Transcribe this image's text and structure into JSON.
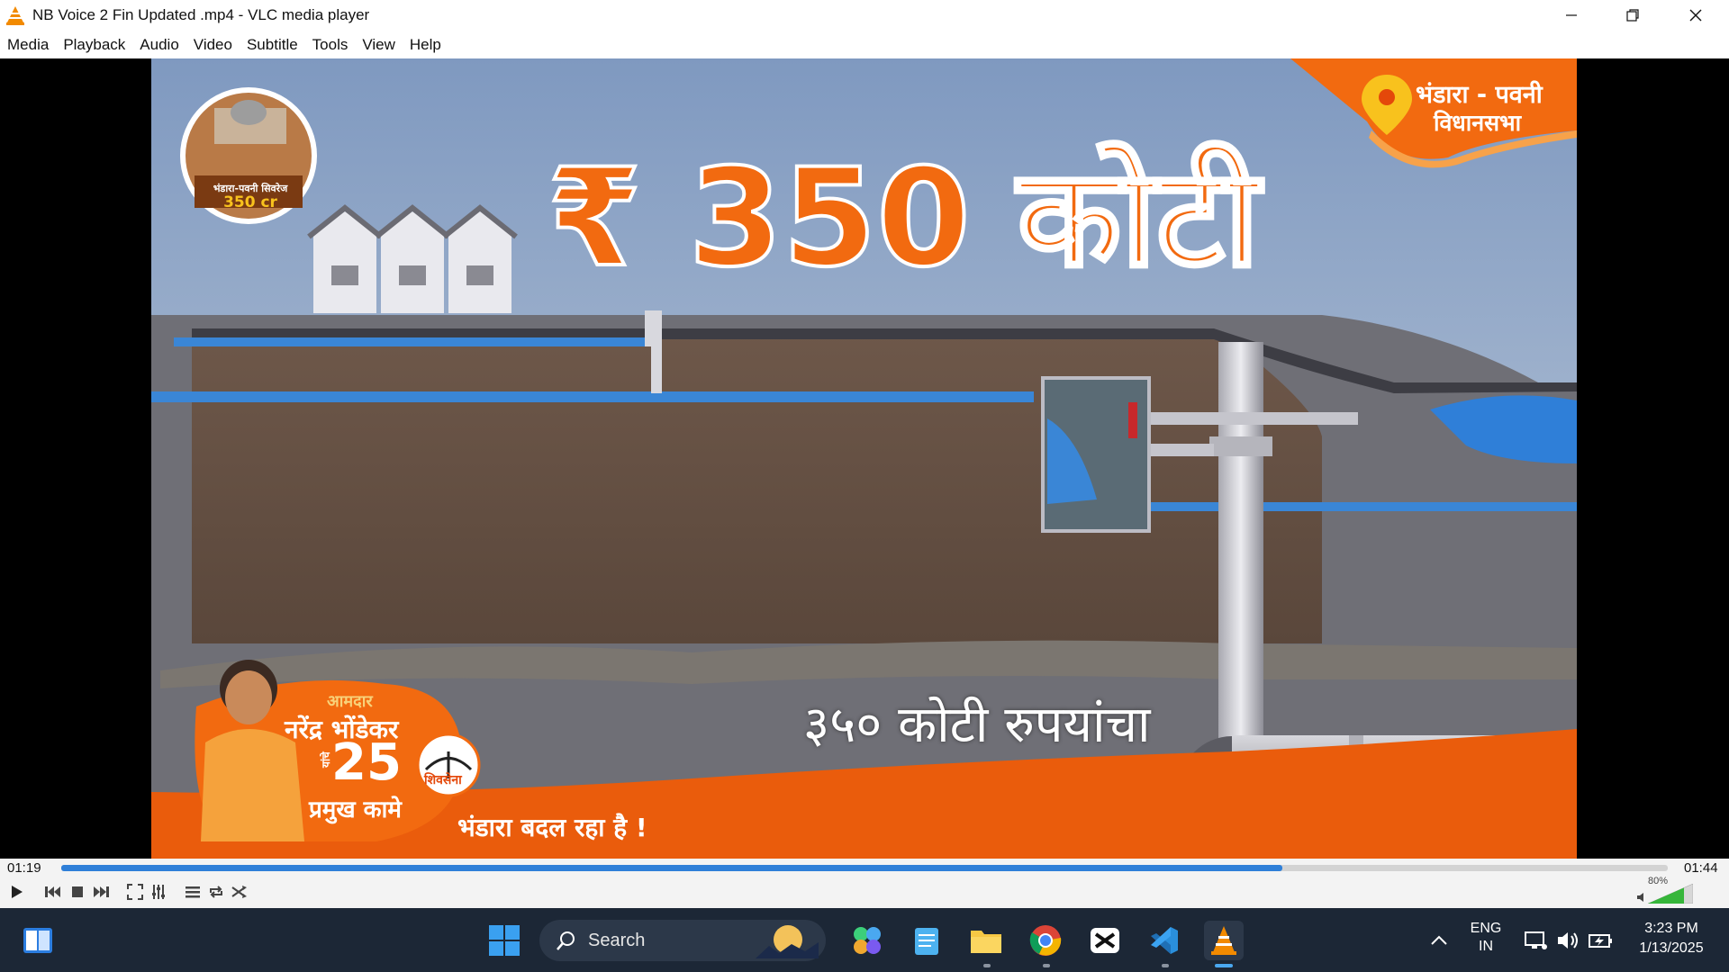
{
  "window": {
    "title": "NB Voice 2 Fin Updated .mp4 - VLC media player"
  },
  "menu": [
    "Media",
    "Playback",
    "Audio",
    "Video",
    "Subtitle",
    "Tools",
    "View",
    "Help"
  ],
  "video": {
    "headline": "₹ 350 कोटी",
    "location_line1": "भंडारा - पवनी",
    "location_line2": "विधानसभा",
    "thumb_caption": "भंडारा-पवनी सिवरेज",
    "thumb_amount": "350 cr",
    "subtitle": "३५० कोटी रुपयांचा",
    "badge_amdar": "आमदार",
    "badge_name": "नरेंद्र भोंडेकर",
    "badge_number": "25",
    "badge_side": "यांचे",
    "badge_kaam": "प्रमुख कामे",
    "party": "शिवसेना",
    "tagline": "भंडारा बदल रहा है !"
  },
  "player": {
    "elapsed": "01:19",
    "duration": "01:44",
    "progress_fraction": 0.76,
    "volume_label": "80%",
    "volume_fraction": 0.8
  },
  "taskbar": {
    "search_label": "Search",
    "lang_line1": "ENG",
    "lang_line2": "IN",
    "clock_time": "3:23 PM",
    "clock_date": "1/13/2025"
  },
  "colors": {
    "accent": "#2f7fd8",
    "orange": "#f26a10",
    "taskbar": "#1c2736"
  }
}
